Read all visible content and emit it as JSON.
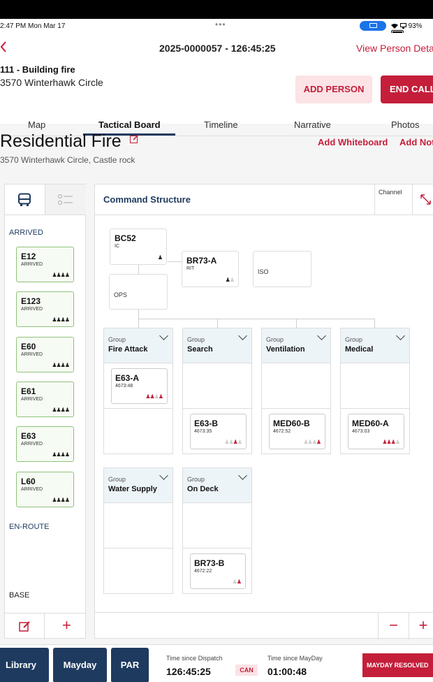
{
  "status_bar": {
    "time": "2:47 PM  Mon Mar 17",
    "dots": "•••",
    "battery": "93%"
  },
  "header": {
    "back_glyph": "<",
    "title": "2025-0000057 - 126:45:25",
    "view_person": "View Person Detai",
    "incident_type": "111 - Building fire",
    "incident_address": "3570 Winterhawk Circle",
    "add_person": "ADD PERSON",
    "end_call": "END CALL"
  },
  "tabs": [
    "Map",
    "Tactical Board",
    "Timeline",
    "Narrative",
    "Photos"
  ],
  "active_tab": "Tactical Board",
  "page": {
    "title": "Residential Fire",
    "address": "3570 Winterhawk Circle, Castle rock",
    "add_whiteboard": "Add Whiteboard",
    "add_note": "Add Not"
  },
  "left_panel": {
    "arrived_label": "ARRIVED",
    "enroute_label": "EN-ROUTE",
    "base_label": "BASE",
    "units": [
      {
        "name": "E12",
        "status": "ARRIVED",
        "people": "♟♟♟♟"
      },
      {
        "name": "E123",
        "status": "ARRIVED",
        "people": "♟♟♟♟"
      },
      {
        "name": "E60",
        "status": "ARRIVED",
        "people": "♟♟♟♟"
      },
      {
        "name": "E61",
        "status": "ARRIVED",
        "people": "♟♟♟♟"
      },
      {
        "name": "E63",
        "status": "ARRIVED",
        "people": "♟♟♟♟"
      },
      {
        "name": "L60",
        "status": "ARRIVED",
        "people": "♟♟♟♟"
      }
    ],
    "add_glyph": "+"
  },
  "board": {
    "title": "Command Structure",
    "channel": "Channel",
    "command": {
      "bc52": {
        "name": "BC52",
        "role": "IC"
      },
      "br73a": {
        "name": "BR73-A",
        "role": "RIT"
      },
      "iso": "ISO",
      "ops": "OPS"
    },
    "group_label": "Group",
    "groups": [
      {
        "name": "Fire Attack"
      },
      {
        "name": "Search"
      },
      {
        "name": "Ventilation"
      },
      {
        "name": "Medical"
      },
      {
        "name": "Water Supply"
      },
      {
        "name": "On Deck"
      }
    ],
    "assigned_units": [
      {
        "name": "E63-A",
        "time": "4673:48"
      },
      {
        "name": "E63-B",
        "time": "4673:35"
      },
      {
        "name": "MED60-B",
        "time": "4672:52"
      },
      {
        "name": "MED60-A",
        "time": "4673:03"
      },
      {
        "name": "BR73-B",
        "time": "4672:22"
      }
    ],
    "minus_glyph": "−",
    "plus_glyph": "+"
  },
  "footer": {
    "library": "Library",
    "mayday": "Mayday",
    "par": "PAR",
    "since_dispatch_label": "Time since Dispatch",
    "since_dispatch_value": "126:45:25",
    "can": "CAN",
    "since_mayday_label": "Time since MayDay",
    "since_mayday_value": "01:00:48",
    "mayday_resolved": "MAYDAY RESOLVED"
  },
  "colors": {
    "accent_red": "#c41e3a",
    "navy": "#1e3a5f",
    "arrived_green": "#8fc27a"
  }
}
